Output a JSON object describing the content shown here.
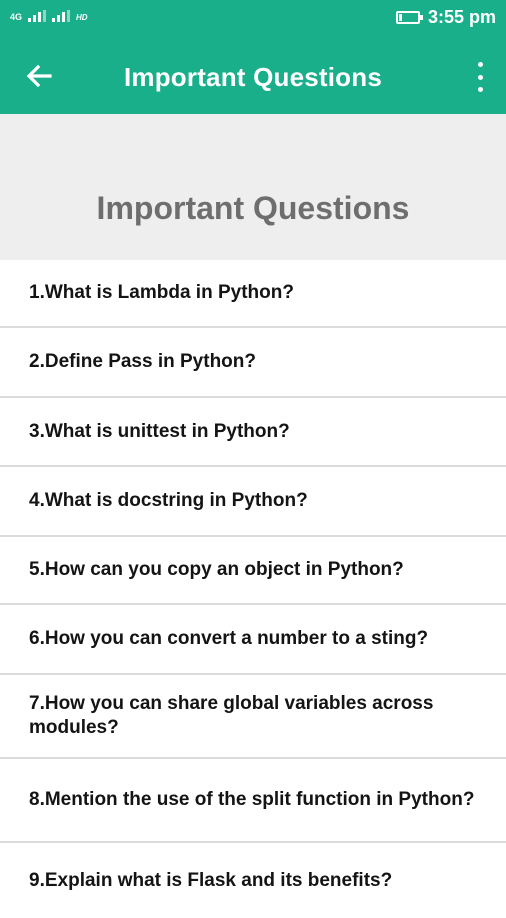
{
  "status_bar": {
    "network_label": "4G",
    "hd_label": "HD",
    "time": "3:55 pm",
    "battery_level": 0.15
  },
  "app_bar": {
    "title": "Important Questions",
    "back_icon": "arrow-left-icon",
    "menu_icon": "more-vert-icon"
  },
  "header": {
    "title": "Important Questions"
  },
  "questions": [
    "1.What is Lambda in Python?",
    "2.Define Pass in Python?",
    "3.What is unittest in Python?",
    "4.What is docstring in Python?",
    "5.How can you copy an object in Python?",
    "6.How you can convert a number to a sting?",
    "7.How you can share global variables across modules?",
    "8.Mention the use of the split function in Python?",
    "9.Explain what is Flask and its benefits?"
  ],
  "colors": {
    "primary": "#1aaf8b",
    "banner_bg": "#eeeeee",
    "banner_text": "#6e6e6e"
  }
}
